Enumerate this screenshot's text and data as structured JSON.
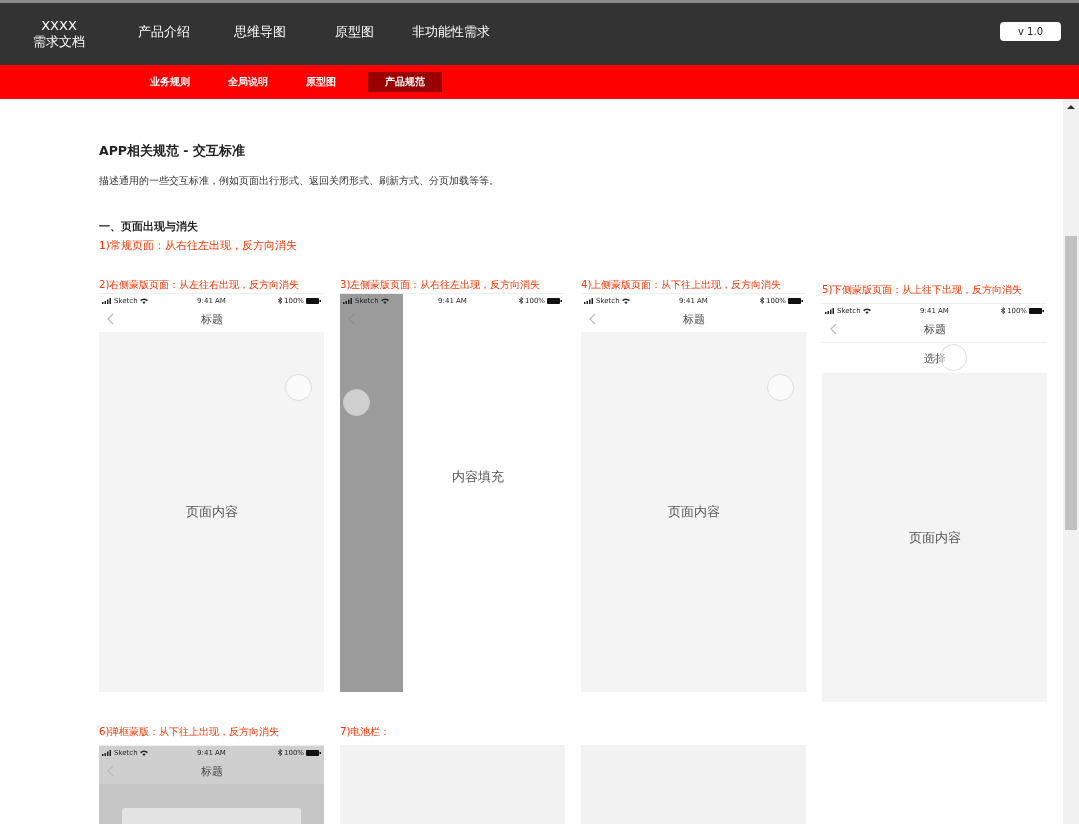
{
  "header": {
    "logo": [
      "XXXX",
      "需求文档"
    ],
    "nav": [
      {
        "label": "产品介绍",
        "selected": false
      },
      {
        "label": "思维导图",
        "selected": false
      },
      {
        "label": "原型图",
        "selected": false
      },
      {
        "label": "非功能性需求",
        "selected": false
      }
    ],
    "version": "v 1.0"
  },
  "subnav": [
    {
      "label": "业务规则",
      "selected": false
    },
    {
      "label": "全局说明",
      "selected": false
    },
    {
      "label": "原型图",
      "selected": false
    },
    {
      "label": "产品规范",
      "selected": true
    }
  ],
  "page": {
    "title": "APP相关规范  -  交互标准",
    "description": "描述通用的一些交互标准，例如页面出行形式、返回关闭形式、刷新方式、分页加载等等。",
    "section": "一、页面出现与消失",
    "note": "1)常规页面：从右往左出现，反方向消失",
    "examples": [
      {
        "caption": "2)右侧蒙版页面：从左往右出现，反方向消失",
        "kind": "normal",
        "phone": {
          "carrier": "Sketch",
          "time": "9:41 AM",
          "battery": "100%",
          "title": "标题",
          "content": "页面内容"
        }
      },
      {
        "caption": "3)左侧蒙版页面：从右往左出现，反方向消失",
        "kind": "left-mask",
        "phone": {
          "carrier": "Sketch",
          "time": "9:41 AM",
          "battery": "100%",
          "content": "内容填充"
        }
      },
      {
        "caption": "4)上侧蒙版页面：从下往上出现，反方向消失",
        "kind": "normal",
        "phone": {
          "carrier": "Sketch",
          "time": "9:41 AM",
          "battery": "100%",
          "title": "标题",
          "content": "页面内容"
        }
      },
      {
        "caption": "5)下侧蒙版页面：从上往下出现，反方向消失",
        "kind": "select",
        "phone": {
          "carrier": "Sketch",
          "time": "9:41 AM",
          "battery": "100%",
          "title": "标题",
          "option": "选择",
          "content": "页面内容"
        }
      },
      {
        "caption": "6)弹框蒙版：从下往上出现，反方向消失",
        "kind": "dialog",
        "phone": {
          "carrier": "Sketch",
          "time": "9:41 AM",
          "battery": "100%",
          "title": "标题"
        }
      },
      {
        "caption": "7)电池栏：",
        "kind": "blank"
      },
      {
        "kind": "blank"
      }
    ]
  }
}
